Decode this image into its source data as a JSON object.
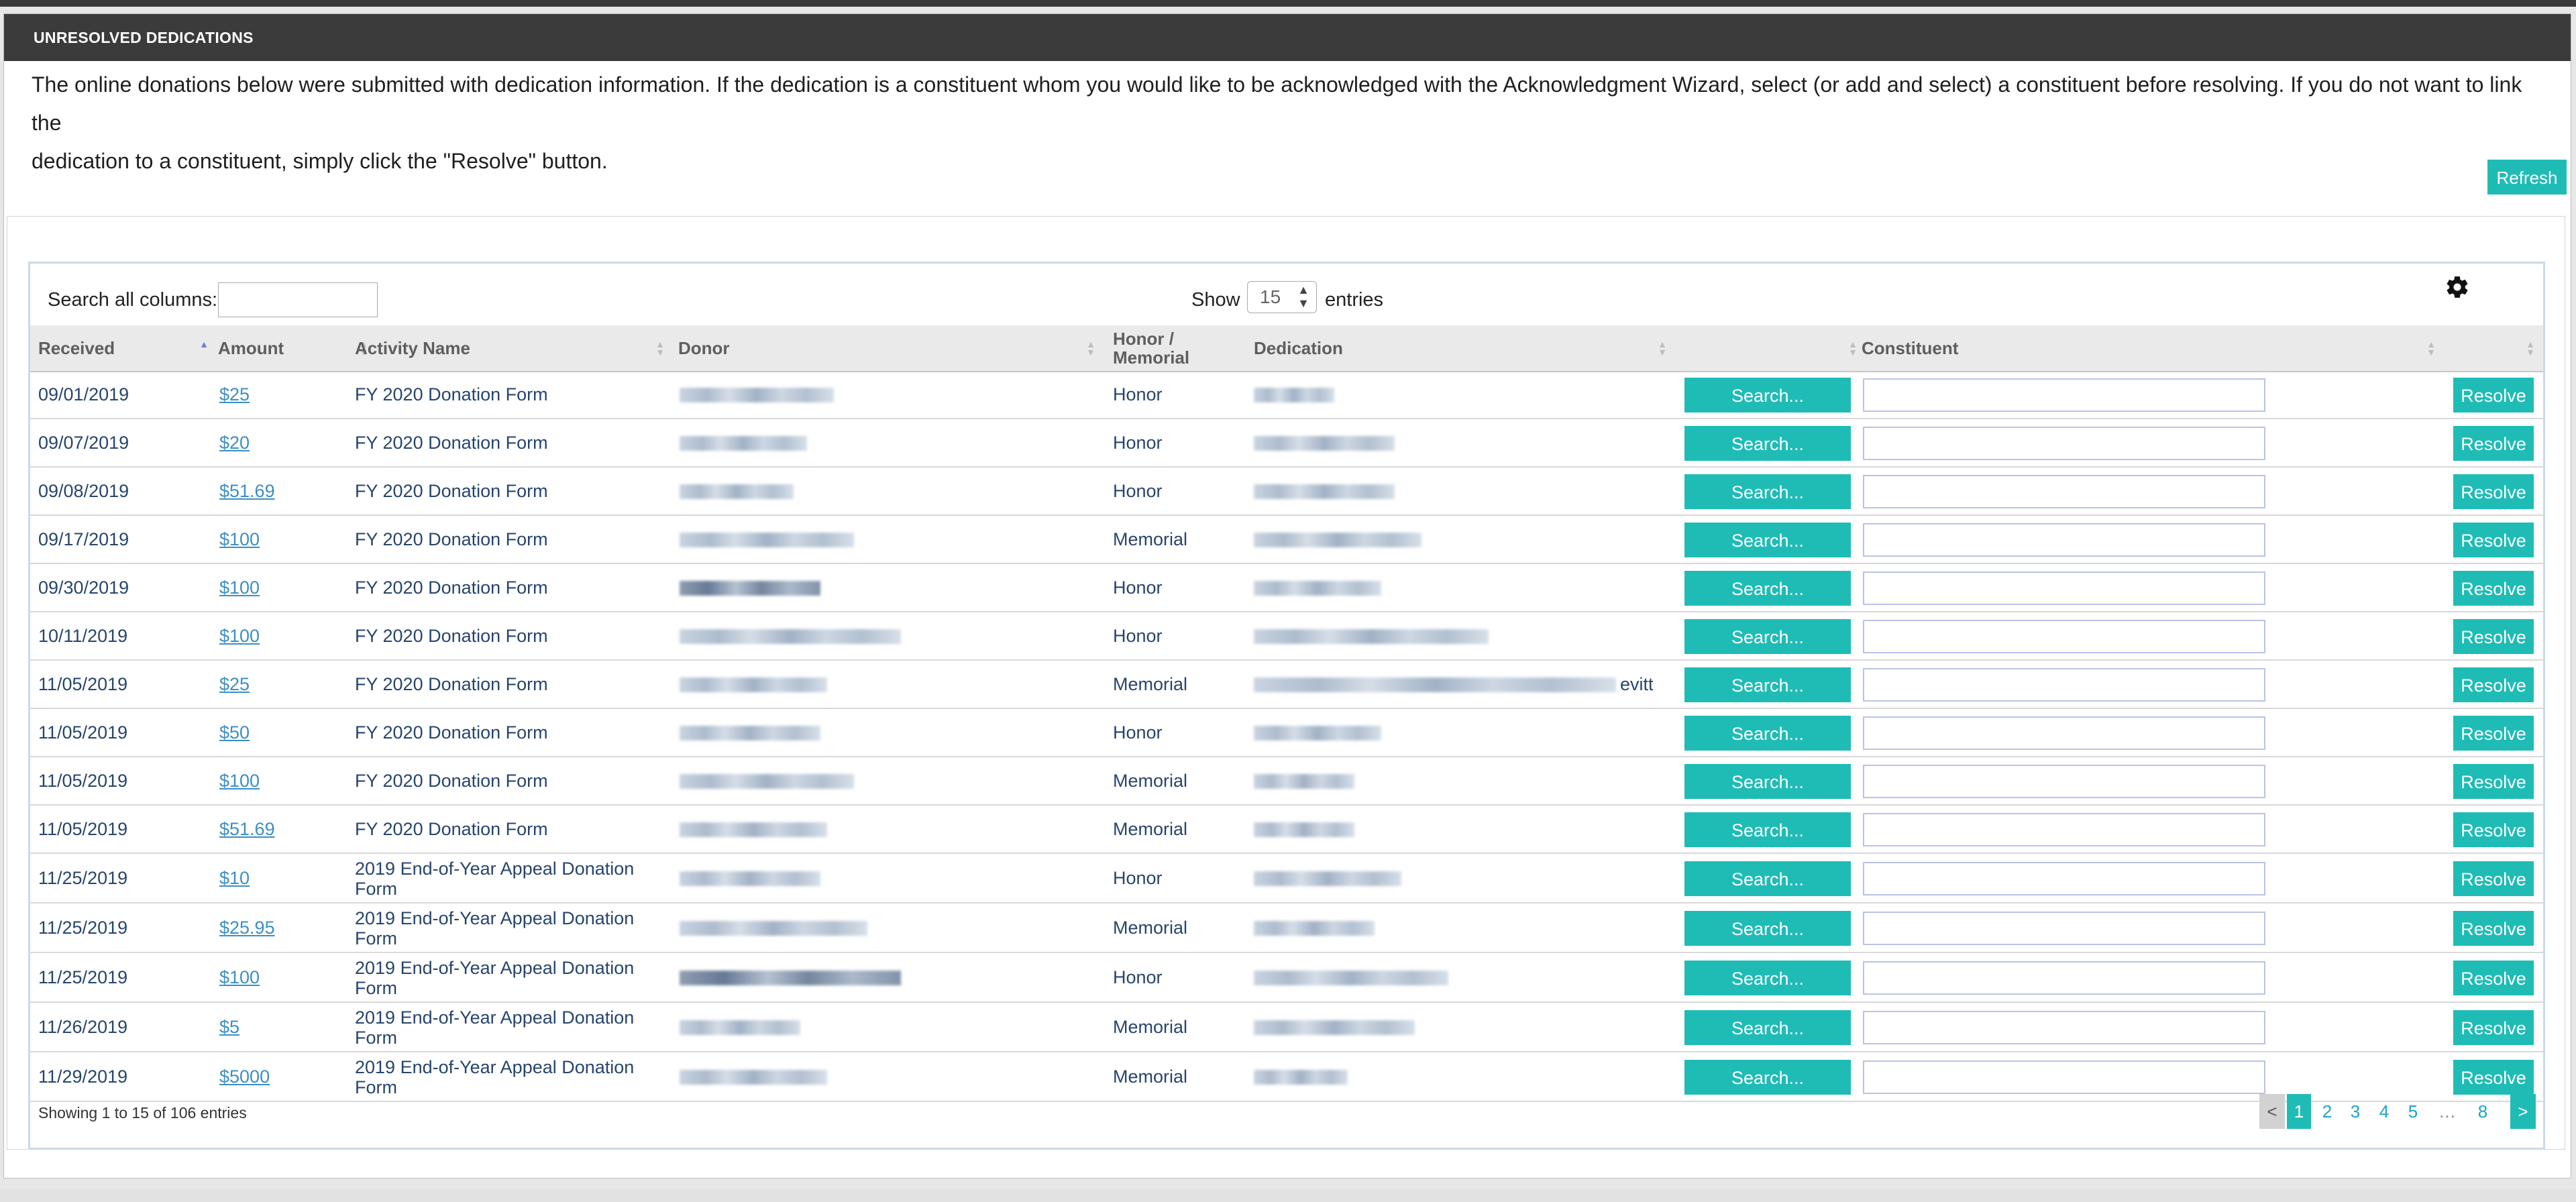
{
  "panel": {
    "title": "UNRESOLVED DEDICATIONS",
    "intro_line1": "The online donations below were submitted with dedication information. If the dedication is a constituent whom you would like to be acknowledged with the Acknowledgment Wizard, select (or add and select) a constituent before resolving. If you do not want to link the",
    "intro_line2": "dedication to a constituent, simply click the \"Resolve\" button.",
    "refresh_label": "Refresh"
  },
  "controls": {
    "search_label": "Search all columns:",
    "show_label": "Show",
    "show_value": "15",
    "entries_label": "entries",
    "settings_icon": "gear-icon"
  },
  "columns": {
    "received": "Received",
    "amount": "Amount",
    "activity": "Activity Name",
    "donor": "Donor",
    "honor_line1": "Honor /",
    "honor_line2": "Memorial",
    "dedication": "Dedication",
    "constituent": "Constituent"
  },
  "row_actions": {
    "search_label": "Search...",
    "resolve_label": "Resolve"
  },
  "rows": [
    {
      "received": "09/01/2019",
      "amount": "$25",
      "activity": "FY 2020 Donation Form",
      "honor": "Honor"
    },
    {
      "received": "09/07/2019",
      "amount": "$20",
      "activity": "FY 2020 Donation Form",
      "honor": "Honor"
    },
    {
      "received": "09/08/2019",
      "amount": "$51.69",
      "activity": "FY 2020 Donation Form",
      "honor": "Honor"
    },
    {
      "received": "09/17/2019",
      "amount": "$100",
      "activity": "FY 2020 Donation Form",
      "honor": "Memorial"
    },
    {
      "received": "09/30/2019",
      "amount": "$100",
      "activity": "FY 2020 Donation Form",
      "honor": "Honor"
    },
    {
      "received": "10/11/2019",
      "amount": "$100",
      "activity": "FY 2020 Donation Form",
      "honor": "Honor"
    },
    {
      "received": "11/05/2019",
      "amount": "$25",
      "activity": "FY 2020 Donation Form",
      "honor": "Memorial",
      "dedication_suffix": "evitt"
    },
    {
      "received": "11/05/2019",
      "amount": "$50",
      "activity": "FY 2020 Donation Form",
      "honor": "Honor"
    },
    {
      "received": "11/05/2019",
      "amount": "$100",
      "activity": "FY 2020 Donation Form",
      "honor": "Memorial"
    },
    {
      "received": "11/05/2019",
      "amount": "$51.69",
      "activity": "FY 2020 Donation Form",
      "honor": "Memorial"
    },
    {
      "received": "11/25/2019",
      "amount": "$10",
      "activity": "2019 End-of-Year Appeal Donation Form",
      "honor": "Honor"
    },
    {
      "received": "11/25/2019",
      "amount": "$25.95",
      "activity": "2019 End-of-Year Appeal Donation Form",
      "honor": "Memorial"
    },
    {
      "received": "11/25/2019",
      "amount": "$100",
      "activity": "2019 End-of-Year Appeal Donation Form",
      "honor": "Honor"
    },
    {
      "received": "11/26/2019",
      "amount": "$5",
      "activity": "2019 End-of-Year Appeal Donation Form",
      "honor": "Memorial"
    },
    {
      "received": "11/29/2019",
      "amount": "$5000",
      "activity": "2019 End-of-Year Appeal Donation Form",
      "honor": "Memorial"
    }
  ],
  "footer": {
    "showing": "Showing 1 to 15 of 106 entries",
    "prev": "<",
    "pages": [
      "1",
      "2",
      "3",
      "4",
      "5",
      "…",
      "8"
    ],
    "next": ">"
  },
  "colors": {
    "accent": "#1fbcb6",
    "header_bg": "#3b3b3b",
    "link": "#3c8fc4"
  }
}
